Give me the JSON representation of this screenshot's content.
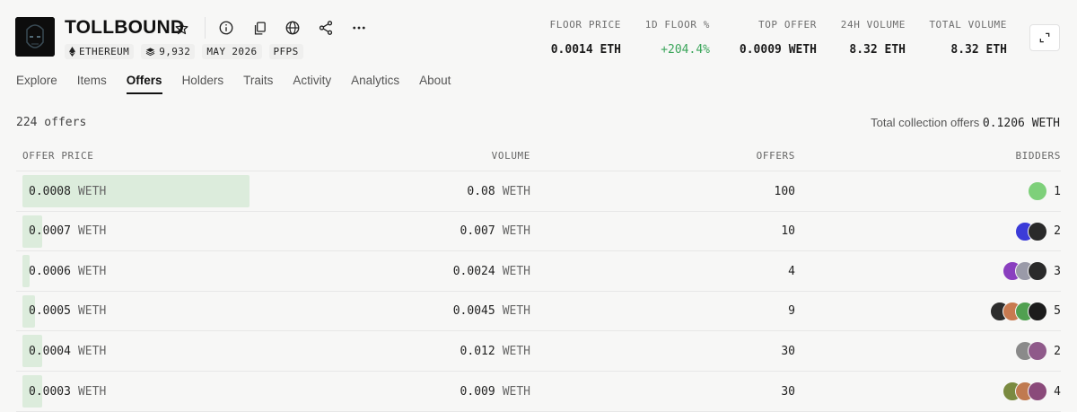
{
  "collection": {
    "title": "TOLLBOUND",
    "chain": "ETHEREUM",
    "items": "9,932",
    "date": "MAY 2026",
    "tag": "PFPS"
  },
  "stats": [
    {
      "label": "FLOOR PRICE",
      "value": "0.0014 ETH"
    },
    {
      "label": "1D FLOOR %",
      "value": "+204.4%"
    },
    {
      "label": "TOP OFFER",
      "value": "0.0009 WETH"
    },
    {
      "label": "24H VOLUME",
      "value": "8.32 ETH"
    },
    {
      "label": "TOTAL VOLUME",
      "value": "8.32 ETH"
    }
  ],
  "tabs": [
    "Explore",
    "Items",
    "Offers",
    "Holders",
    "Traits",
    "Activity",
    "Analytics",
    "About"
  ],
  "active_tab": "Offers",
  "summary": {
    "count": "224 offers",
    "total_label": "Total collection offers",
    "total_value": "0.1206 WETH"
  },
  "table": {
    "headers": [
      "OFFER PRICE",
      "VOLUME",
      "OFFERS",
      "BIDDERS"
    ],
    "rows": [
      {
        "price": "0.0008",
        "unit": "WETH",
        "volume": "0.08",
        "vol_unit": "WETH",
        "offers": "100",
        "bidders": "1",
        "bar_fraction": 0.93,
        "avatars": [
          "#7ed07a"
        ]
      },
      {
        "price": "0.0007",
        "unit": "WETH",
        "volume": "0.007",
        "vol_unit": "WETH",
        "offers": "10",
        "bidders": "2",
        "bar_fraction": 0.08,
        "avatars": [
          "#3b3bd8",
          "#2a2a2a"
        ]
      },
      {
        "price": "0.0006",
        "unit": "WETH",
        "volume": "0.0024",
        "vol_unit": "WETH",
        "offers": "4",
        "bidders": "3",
        "bar_fraction": 0.03,
        "avatars": [
          "#8a3fbf",
          "#9a9aa8",
          "#2a2a2a"
        ]
      },
      {
        "price": "0.0005",
        "unit": "WETH",
        "volume": "0.0045",
        "vol_unit": "WETH",
        "offers": "9",
        "bidders": "5",
        "bar_fraction": 0.05,
        "avatars": [
          "#2d2d2d",
          "#c87a50",
          "#50a050",
          "#1c1c1c"
        ]
      },
      {
        "price": "0.0004",
        "unit": "WETH",
        "volume": "0.012",
        "vol_unit": "WETH",
        "offers": "30",
        "bidders": "2",
        "bar_fraction": 0.08,
        "avatars": [
          "#8a8a8a",
          "#8f5a8a"
        ]
      },
      {
        "price": "0.0003",
        "unit": "WETH",
        "volume": "0.009",
        "vol_unit": "WETH",
        "offers": "30",
        "bidders": "4",
        "bar_fraction": 0.08,
        "avatars": [
          "#7a8a40",
          "#c07a50",
          "#8a4a7a"
        ]
      }
    ]
  },
  "colors": {
    "accent_green": "#3aa55a",
    "bar_fill": "#dcecdc"
  }
}
